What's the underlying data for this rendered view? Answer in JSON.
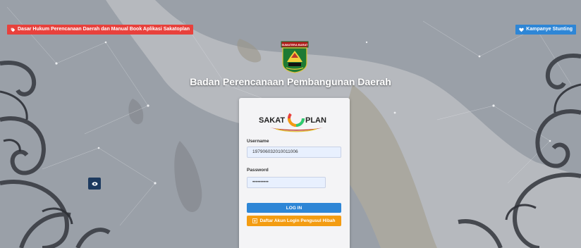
{
  "header": {
    "legal_basis_link": "Dasar Hukum Perencanaan Daerah dan Manual Book Aplikasi Sakatoplan",
    "stunting_link": "Kampanye Stunting",
    "logo_caption": "SUMATERA BARAT",
    "agency_name": "Badan Perencanaan Pembangunan Daerah"
  },
  "brand": {
    "left": "SAKAT",
    "right": "PLAN"
  },
  "login_form": {
    "username_label": "Username",
    "username_value": "197906032010011006",
    "password_label": "Password",
    "password_value": "••••••••••",
    "login_button": "LOG IN",
    "register_button": "Daftar Akun Login Pengusul Hibah"
  },
  "colors": {
    "red_ribbon": "#e8413c",
    "blue_accent": "#2e86d6",
    "orange_button": "#f39c12",
    "navy_eye_button": "#1d3a5f"
  },
  "icons": {
    "legal_basis": "tag-icon",
    "stunting": "heart-icon",
    "password_toggle": "eye-icon",
    "register": "plus-square-icon"
  }
}
